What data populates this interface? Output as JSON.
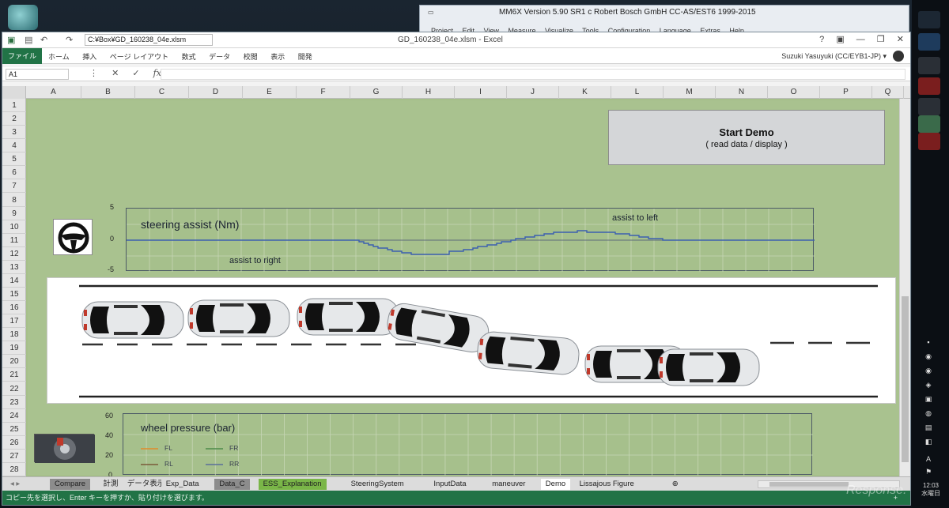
{
  "mm6x": {
    "title": "MM6X Version 5.90 SR1 c Robert Bosch GmbH CC-AS/EST6 1999-2015",
    "menu": [
      "Project",
      "Edit",
      "View",
      "Measure",
      "Visualize",
      "Tools",
      "Configuration",
      "Language",
      "Extras",
      "Help"
    ]
  },
  "excel": {
    "file_path": "C:¥Box¥GD_160238_04e.xlsm",
    "doc_title": "GD_160238_04e.xlsm - Excel",
    "window_controls": [
      "?",
      "▣",
      "—",
      "❐",
      "✕"
    ],
    "file_tab": "ファイル",
    "ribbon_tabs": [
      "ホーム",
      "挿入",
      "ページ レイアウト",
      "数式",
      "データ",
      "校閲",
      "表示",
      "開発"
    ],
    "user": "Suzuki Yasuyuki (CC/EYB1-JP) ▾",
    "name_box": "A1",
    "fx_icons": [
      "⋮",
      "✕",
      "✓",
      "fx"
    ],
    "columns": [
      "A",
      "B",
      "C",
      "D",
      "E",
      "F",
      "G",
      "H",
      "I",
      "J",
      "K",
      "L",
      "M",
      "N",
      "O",
      "P",
      "Q"
    ],
    "rows": [
      "1",
      "2",
      "3",
      "4",
      "5",
      "6",
      "7",
      "8",
      "9",
      "10",
      "11",
      "12",
      "13",
      "14",
      "15",
      "16",
      "17",
      "18",
      "19",
      "20",
      "21",
      "22",
      "23",
      "24",
      "25",
      "26",
      "27",
      "28"
    ]
  },
  "demo_button": {
    "title": "Start Demo",
    "subtitle": "( read data / display )"
  },
  "steering_chart": {
    "title": "steering assist (Nm)",
    "yticks": [
      "5",
      "0",
      "-5"
    ],
    "annotations": [
      "assist to right",
      "assist to left"
    ],
    "series_color": "#3b5fb0"
  },
  "pressure_chart": {
    "title": "wheel pressure (bar)",
    "yticks": [
      "60",
      "40",
      "20",
      "0"
    ],
    "legend": [
      {
        "label": "FL",
        "color": "#e08a2a"
      },
      {
        "label": "FR",
        "color": "#4d8a4a"
      },
      {
        "label": "RL",
        "color": "#7a5a3a"
      },
      {
        "label": "RR",
        "color": "#5a6f9a"
      }
    ]
  },
  "sheet_tabs": [
    {
      "label": "Compare",
      "bg": "#8c8c8c"
    },
    {
      "label": "計測",
      "bg": "#dcdcdc"
    },
    {
      "label": "データ表示",
      "bg": "#dcdcdc"
    },
    {
      "label": "Exp_Data",
      "bg": "#dcdcdc"
    },
    {
      "label": "Data_C",
      "bg": "#8c8c8c"
    },
    {
      "label": "ESS_Explanation",
      "bg": "#7ab648"
    },
    {
      "label": "SteeringSystem",
      "bg": "#dcdcdc"
    },
    {
      "label": "InputData",
      "bg": "#dcdcdc"
    },
    {
      "label": "maneuver",
      "bg": "#dcdcdc"
    },
    {
      "label": "Demo",
      "bg": "#ffffff"
    },
    {
      "label": "Lissajous Figure",
      "bg": "#dcdcdc"
    },
    {
      "label": "⊕",
      "bg": "#dcdcdc"
    }
  ],
  "status": {
    "text": "コピー先を選択し、Enter キーを押すか、貼り付けを選びます。",
    "zoom": "+"
  },
  "taskbar": {
    "clock_time": "12:03",
    "clock_day": "水曜日"
  },
  "watermark": "Response."
}
